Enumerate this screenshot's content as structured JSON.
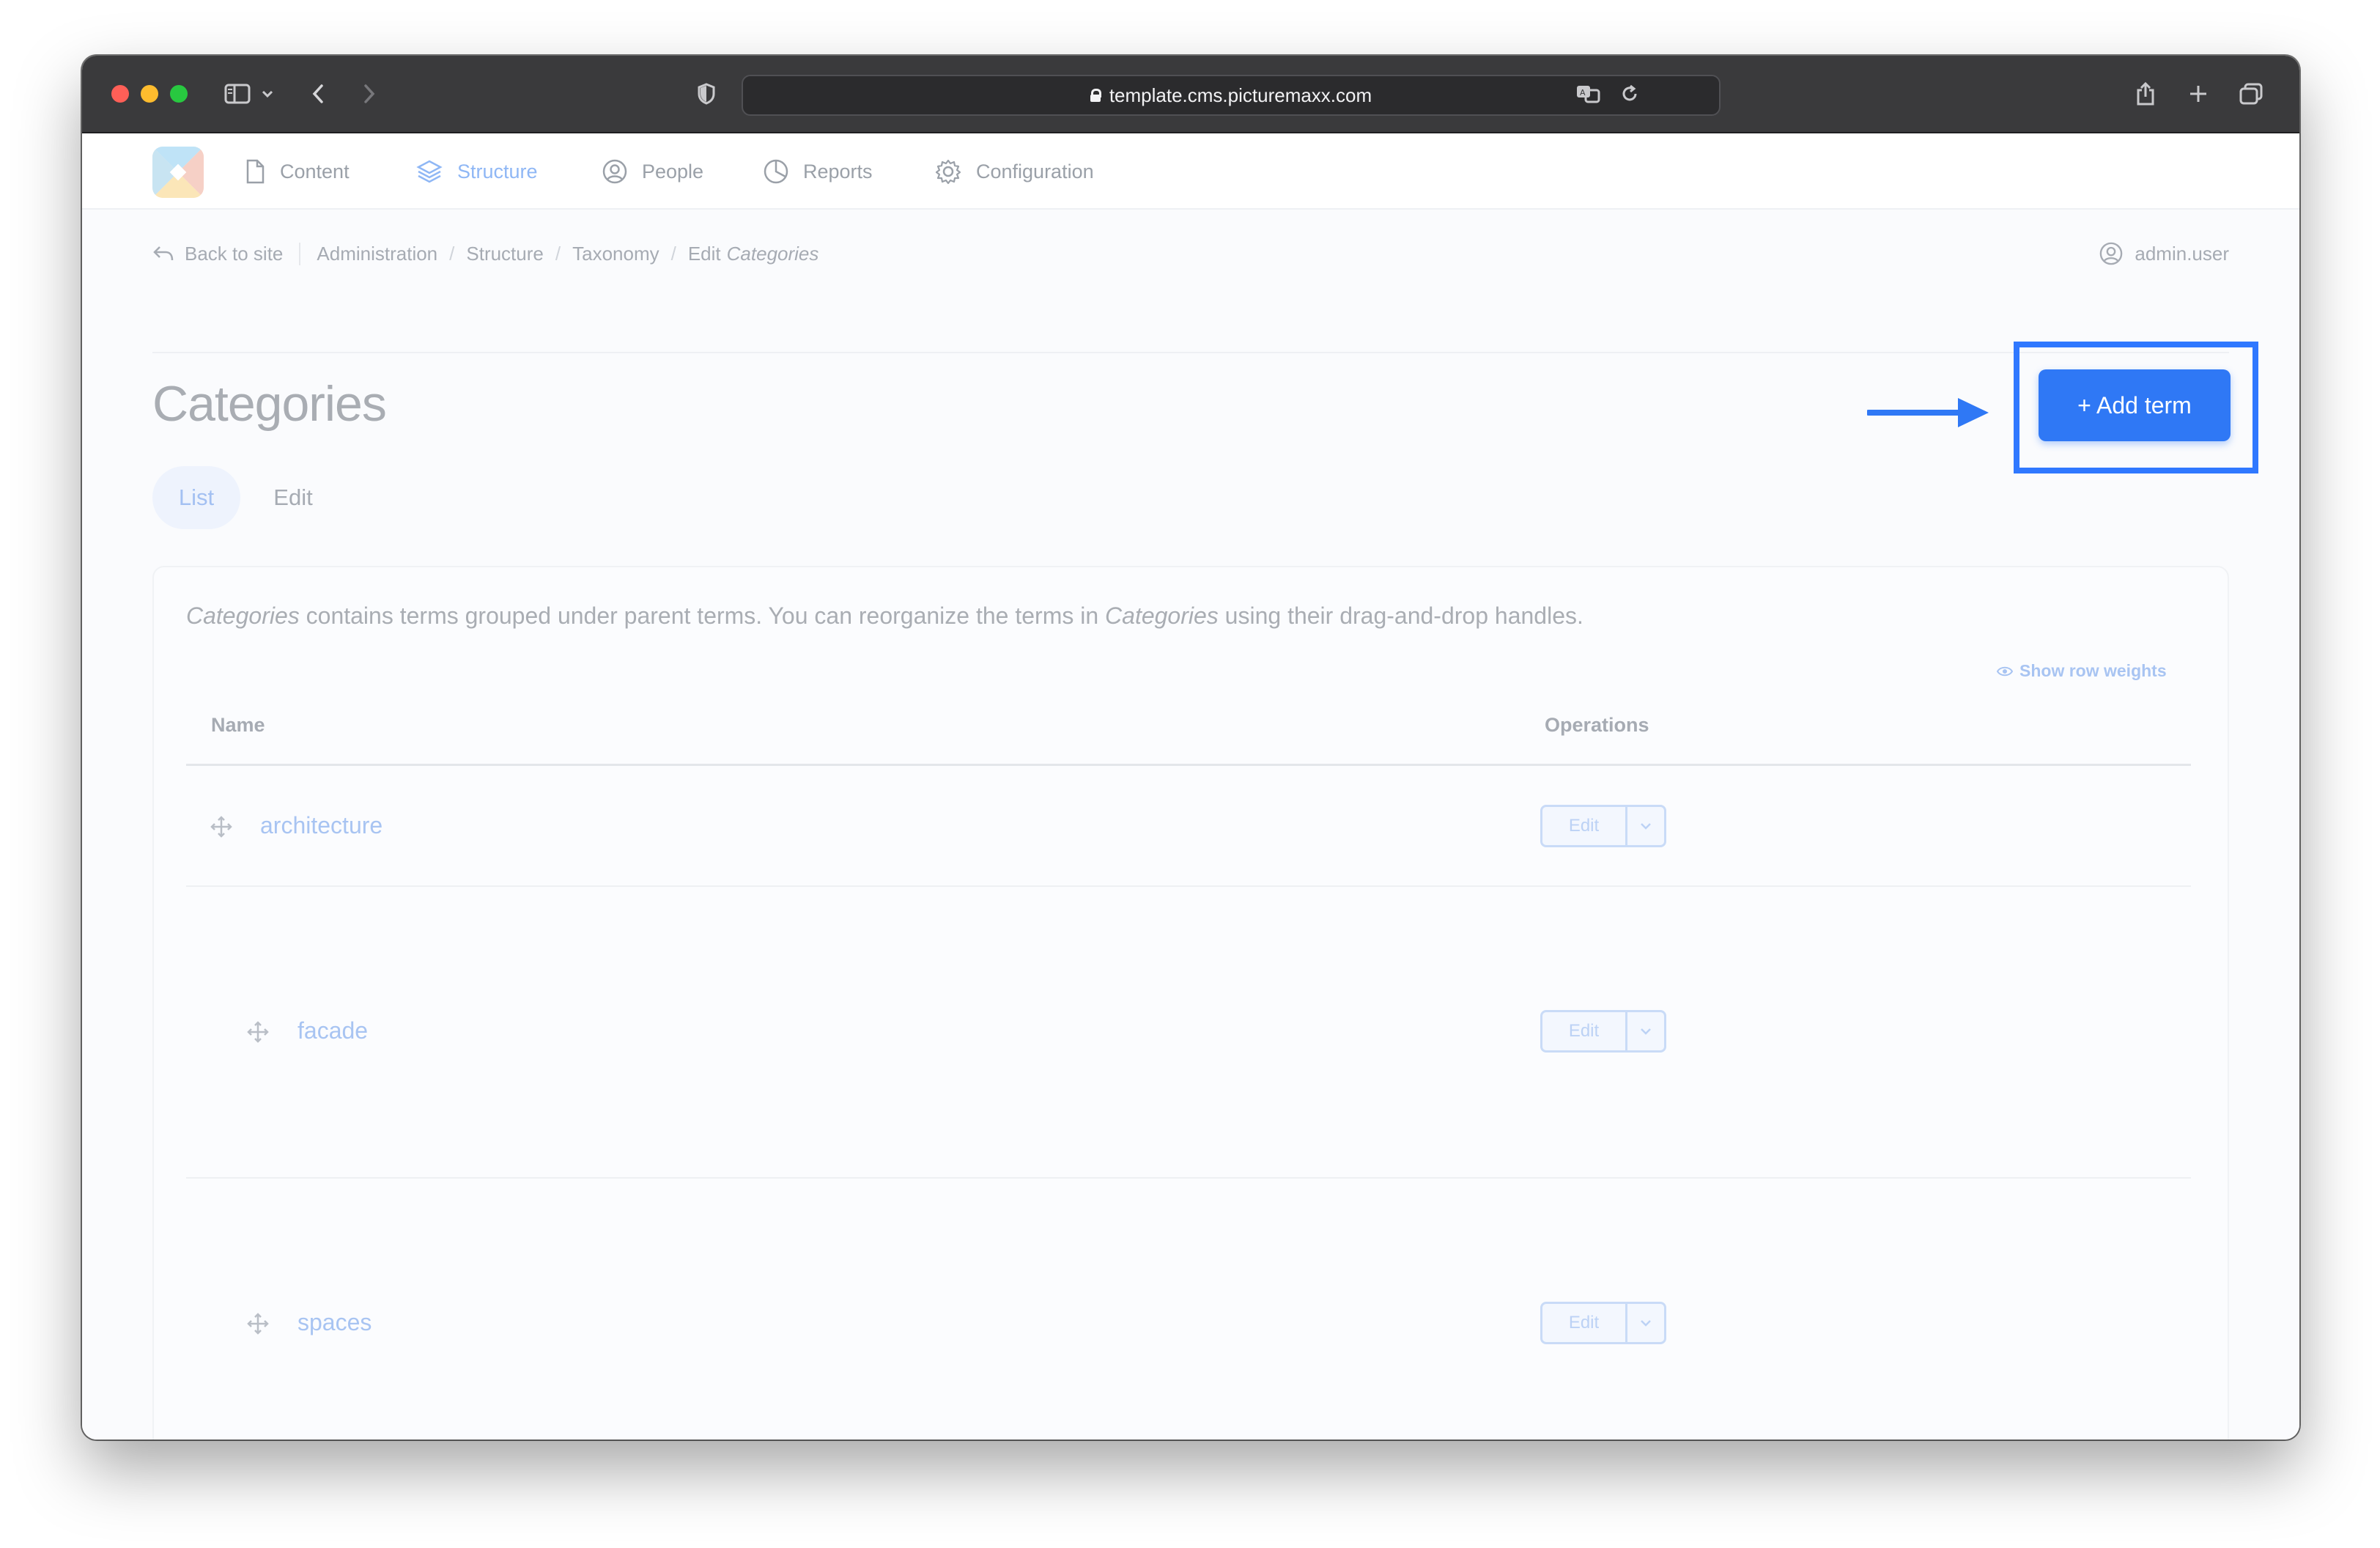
{
  "browser": {
    "url": "template.cms.picturemaxx.com"
  },
  "nav": {
    "items": [
      {
        "label": "Content"
      },
      {
        "label": "Structure"
      },
      {
        "label": "People"
      },
      {
        "label": "Reports"
      },
      {
        "label": "Configuration"
      }
    ]
  },
  "breadcrumb": {
    "back": "Back to site",
    "items": [
      "Administration",
      "Structure",
      "Taxonomy"
    ],
    "current_prefix": "Edit",
    "current_em": "Categories"
  },
  "user": {
    "name": "admin.user"
  },
  "page": {
    "title": "Categories",
    "tabs": [
      {
        "label": "List",
        "active": true
      },
      {
        "label": "Edit",
        "active": false
      }
    ],
    "add_button": "+ Add term"
  },
  "description": {
    "em1": "Categories",
    "text1": " contains terms grouped under parent terms. You can reorganize the terms in ",
    "em2": "Categories",
    "text2": " using their drag-and-drop handles."
  },
  "table": {
    "show_weights": "Show row weights",
    "columns": [
      "Name",
      "Operations"
    ],
    "rows": [
      {
        "name": "architecture",
        "indent": 0,
        "op_label": "Edit"
      },
      {
        "name": "facade",
        "indent": 1,
        "op_label": "Edit"
      },
      {
        "name": "spaces",
        "indent": 1,
        "op_label": "Edit"
      }
    ]
  },
  "colors": {
    "accent": "#2f78f5",
    "highlight": "#2f78ff",
    "link_muted": "#a8c4f2"
  }
}
